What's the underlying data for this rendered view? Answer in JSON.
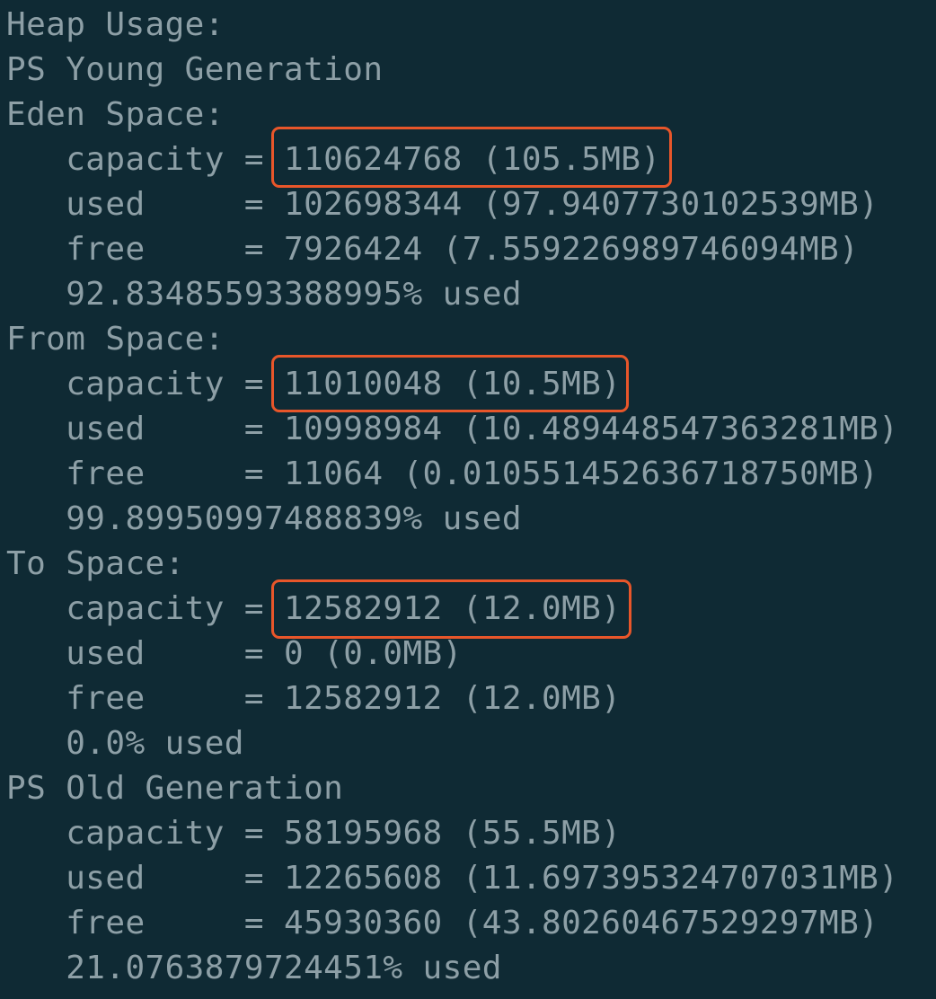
{
  "terminal": {
    "lines": [
      "Heap Usage:",
      "PS Young Generation",
      "Eden Space:",
      "   capacity = 110624768 (105.5MB)",
      "   used     = 102698344 (97.9407730102539MB)",
      "   free     = 7926424 (7.559226989746094MB)",
      "   92.83485593388995% used",
      "From Space:",
      "   capacity = 11010048 (10.5MB)",
      "   used     = 10998984 (10.489448547363281MB)",
      "   free     = 11064 (0.010551452636718750MB)",
      "   99.89950997488839% used",
      "To Space:",
      "   capacity = 12582912 (12.0MB)",
      "   used     = 0 (0.0MB)",
      "   free     = 12582912 (12.0MB)",
      "   0.0% used",
      "PS Old Generation",
      "   capacity = 58195968 (55.5MB)",
      "   used     = 12265608 (11.697395324707031MB)",
      "   free     = 45930360 (43.80260467529297MB)",
      "   21.0763879724451% used"
    ]
  },
  "highlight_color": "#e8562a"
}
